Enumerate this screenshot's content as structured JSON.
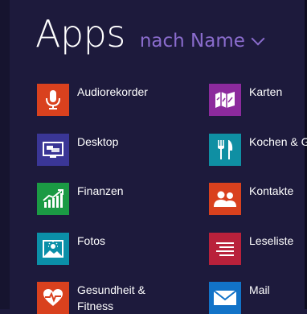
{
  "header": {
    "title": "Apps",
    "sort_label": "nach Name"
  },
  "apps": [
    {
      "label": "Audiorekorder",
      "icon": "microphone-icon",
      "color": "#d9411e"
    },
    {
      "label": "Desktop",
      "icon": "desktop-icon",
      "color": "#3a3696"
    },
    {
      "label": "Finanzen",
      "icon": "finance-chart-icon",
      "color": "#1b9a44"
    },
    {
      "label": "Fotos",
      "icon": "photo-icon",
      "color": "#0b8fa8"
    },
    {
      "label": "Gesundheit &",
      "label_line2": "Fitness",
      "icon": "heart-rate-icon",
      "color": "#d9411e"
    },
    {
      "label": "Karten",
      "icon": "map-icon",
      "color": "#8c2a9d"
    },
    {
      "label": "Kochen & G",
      "icon": "fork-knife-icon",
      "color": "#0f8fa3"
    },
    {
      "label": "Kontakte",
      "icon": "people-icon",
      "color": "#d9411e"
    },
    {
      "label": "Leseliste",
      "icon": "reading-list-icon",
      "color": "#b9213b"
    },
    {
      "label": "Mail",
      "icon": "mail-envelope-icon",
      "color": "#1273c8"
    }
  ]
}
